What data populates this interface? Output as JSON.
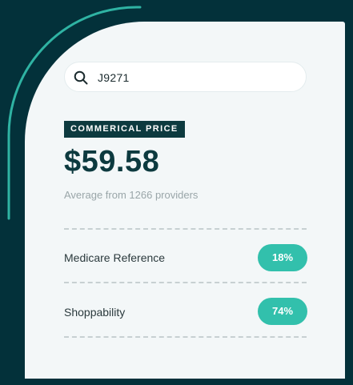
{
  "search": {
    "query": "J9271",
    "icon": "search-icon"
  },
  "price": {
    "badge_label": "COMMERICAL PRICE",
    "value": "$59.58",
    "subtext": "Average from 1266 providers"
  },
  "metrics": [
    {
      "label": "Medicare Reference",
      "value": "18%"
    },
    {
      "label": "Shoppability",
      "value": "74%"
    }
  ],
  "colors": {
    "background": "#03313a",
    "card": "#f3f7f8",
    "accent": "#32c0ac",
    "badge": "#0d3a3f"
  }
}
